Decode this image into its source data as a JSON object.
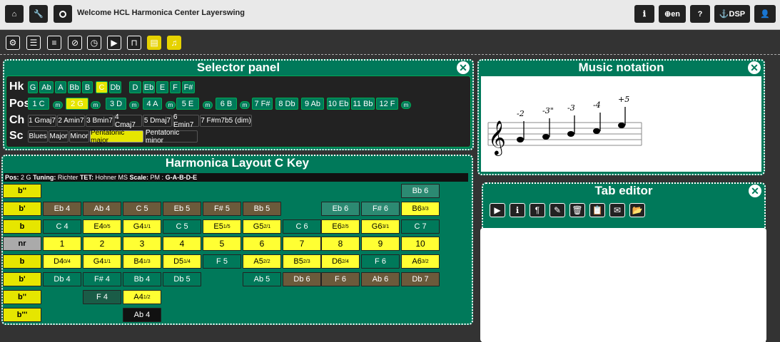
{
  "topbar": {
    "title": "Welcome HCL Harmonica Center Layerswing",
    "home": "home-icon",
    "tools": "wrench-icon",
    "refresh": "circle-icon",
    "info": "info-icon",
    "lang": "en",
    "help": "help-icon",
    "dsp": "DSP",
    "user": "user-icon"
  },
  "toolbar": {
    "icons": [
      "cogs-icon",
      "list-icon",
      "sliders-icon",
      "eye-slash-icon",
      "timer-icon",
      "play-icon",
      "wave-icon",
      "file-icon",
      "music-icon"
    ]
  },
  "selector": {
    "title": "Selector panel",
    "rows": {
      "hk": "Hk",
      "pos": "Pos",
      "ch": "Ch",
      "sc": "Sc"
    },
    "keys": [
      "G",
      "Ab",
      "A",
      "Bb",
      "B",
      "C",
      "Db",
      "D",
      "Eb",
      "E",
      "F",
      "F#"
    ],
    "selected_key": "C",
    "positions": [
      "1 C",
      "2 G",
      "3 D",
      "4 A",
      "5 E",
      "6 B",
      "7 F#",
      "8 Db",
      "9 Ab",
      "10 Eb",
      "11 Bb",
      "12 F"
    ],
    "selected_position": "2 G",
    "m_label": "m",
    "chords": [
      "1 Gmaj7",
      "2 Amin7",
      "3 Bmin7",
      "4 Cmaj7",
      "5 Dmaj7",
      "6 Emin7",
      "7 F#m7b5 (dim)"
    ],
    "scales": [
      "Blues",
      "Major",
      "Minor",
      "Pentatonic major",
      "Pentatonic minor"
    ],
    "selected_scale": "Pentatonic major"
  },
  "notation": {
    "title": "Music notation",
    "labels": [
      "-2",
      "-3\"",
      "-3",
      "-4",
      "+5"
    ]
  },
  "layout": {
    "title": "Harmonica Layout C Key",
    "info": {
      "pos_label": "Pos:",
      "pos": "2 G",
      "tuning_label": "Tuning:",
      "tuning": "Richter",
      "tet_label": "TET:",
      "tet": "Hohner MS",
      "scale_label": "Scale:",
      "scale": "PM :",
      "notes": "G-A-B-D-E"
    },
    "row_labels": [
      "b''",
      "b'",
      "b",
      "nr",
      "b",
      "b'",
      "b''",
      "b'''"
    ],
    "rows": [
      [
        [
          "",
          "e"
        ],
        [
          "",
          "e"
        ],
        [
          "",
          "e"
        ],
        [
          "",
          "e"
        ],
        [
          "",
          "e"
        ],
        [
          "",
          "e"
        ],
        [
          "",
          "e"
        ],
        [
          "",
          "e"
        ],
        [
          "",
          "e"
        ],
        [
          "Bb 6",
          "bg2"
        ]
      ],
      [
        [
          "Eb 4",
          "bg1"
        ],
        [
          "Ab 4",
          "bg1"
        ],
        [
          "C 5",
          "bg1"
        ],
        [
          "Eb 5",
          "bg1"
        ],
        [
          "F# 5",
          "bg1"
        ],
        [
          "Bb 5",
          "bg1"
        ],
        [
          "",
          "e"
        ],
        [
          "Eb 6",
          "bg2"
        ],
        [
          "F# 6",
          "bg2"
        ],
        [
          "B6",
          "yn",
          "3/3"
        ]
      ],
      [
        [
          "C 4",
          "bg3"
        ],
        [
          "E4",
          "yn",
          "0/5"
        ],
        [
          "G4",
          "yn",
          "1/1"
        ],
        [
          "C 5",
          "bg3"
        ],
        [
          "E5",
          "yn",
          "1/5"
        ],
        [
          "G5",
          "yn",
          "2/1"
        ],
        [
          "C 6",
          "bg3"
        ],
        [
          "E6",
          "yn",
          "2/5"
        ],
        [
          "G6",
          "yn",
          "3/1"
        ],
        [
          "C 7",
          "bg3"
        ]
      ],
      [
        [
          "1",
          "num"
        ],
        [
          "2",
          "num"
        ],
        [
          "3",
          "num"
        ],
        [
          "4",
          "num"
        ],
        [
          "5",
          "num"
        ],
        [
          "6",
          "num"
        ],
        [
          "7",
          "num"
        ],
        [
          "8",
          "num"
        ],
        [
          "9",
          "num"
        ],
        [
          "10",
          "num"
        ]
      ],
      [
        [
          "D4",
          "yn",
          "0/4"
        ],
        [
          "G4",
          "yn",
          "1/1"
        ],
        [
          "B4",
          "yn",
          "1/3"
        ],
        [
          "D5",
          "yn",
          "1/4"
        ],
        [
          "F 5",
          "bg3"
        ],
        [
          "A5",
          "yn",
          "2/2"
        ],
        [
          "B5",
          "yn",
          "2/3"
        ],
        [
          "D6",
          "yn",
          "2/4"
        ],
        [
          "F 6",
          "bg3"
        ],
        [
          "A6",
          "yn",
          "3/2"
        ]
      ],
      [
        [
          "Db 4",
          "bg3"
        ],
        [
          "F# 4",
          "bg3"
        ],
        [
          "Bb 4",
          "bg3"
        ],
        [
          "Db 5",
          "bg3"
        ],
        [
          "",
          "e"
        ],
        [
          "Ab 5",
          "bg3"
        ],
        [
          "Db 6",
          "bg1"
        ],
        [
          "F 6",
          "bg1"
        ],
        [
          "Ab 6",
          "bg1"
        ],
        [
          "Db 7",
          "bg1"
        ]
      ],
      [
        [
          "",
          "e"
        ],
        [
          "F 4",
          "bg4"
        ],
        [
          "A4",
          "yn",
          "1/2"
        ],
        [
          "",
          "e"
        ],
        [
          "",
          "e"
        ],
        [
          "",
          "e"
        ],
        [
          "",
          "e"
        ],
        [
          "",
          "e"
        ],
        [
          "",
          "e"
        ],
        [
          "",
          "e"
        ]
      ],
      [
        [
          "",
          "e"
        ],
        [
          "",
          "e"
        ],
        [
          "Ab 4",
          "bk"
        ],
        [
          "",
          "e"
        ],
        [
          "",
          "e"
        ],
        [
          "",
          "e"
        ],
        [
          "",
          "e"
        ],
        [
          "",
          "e"
        ],
        [
          "",
          "e"
        ],
        [
          "",
          "e"
        ]
      ]
    ]
  },
  "tab_editor": {
    "title": "Tab editor",
    "icons": [
      "play-icon",
      "info-icon",
      "paragraph-icon",
      "brush-icon",
      "trash-icon",
      "clipboard-icon",
      "mail-icon",
      "folder-icon"
    ]
  }
}
